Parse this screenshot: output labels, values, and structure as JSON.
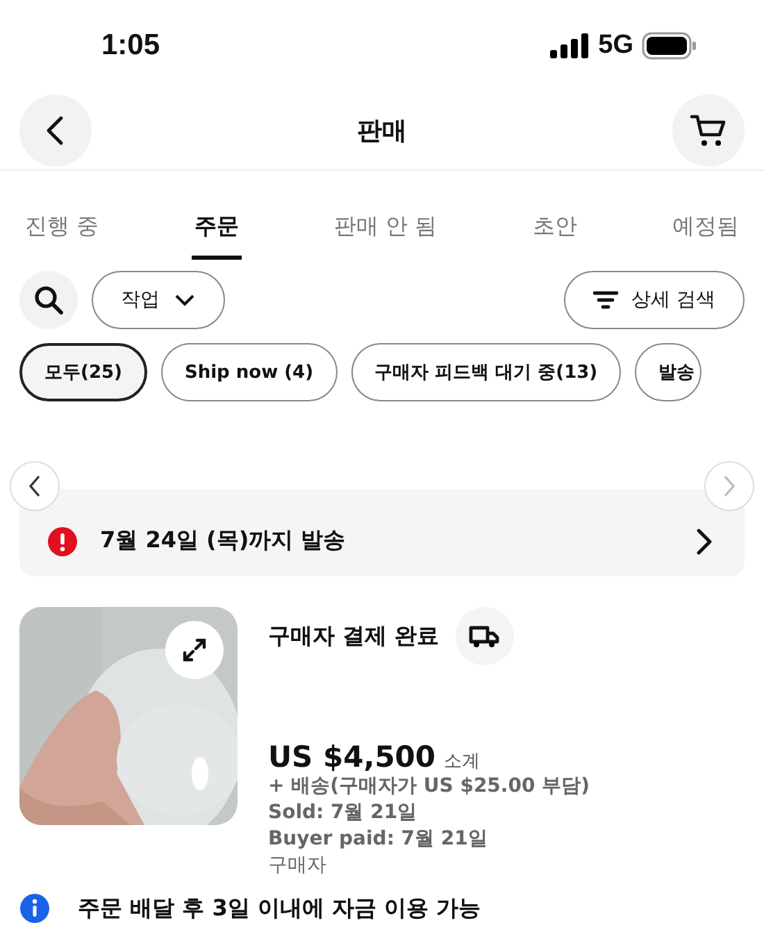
{
  "status_bar": {
    "time": "1:05",
    "network": "5G"
  },
  "header": {
    "title": "판매"
  },
  "tabs": [
    {
      "label": "진행 중",
      "selected": false
    },
    {
      "label": "주문",
      "selected": true
    },
    {
      "label": "판매 안 됨",
      "selected": false
    },
    {
      "label": "초안",
      "selected": false
    },
    {
      "label": "예정됨",
      "selected": false
    }
  ],
  "toolbar": {
    "actions_label": "작업",
    "advanced_search_label": "상세 검색"
  },
  "chips": [
    {
      "label": "모두(25)",
      "selected": true
    },
    {
      "label": "Ship now (4)",
      "selected": false
    },
    {
      "label": "구매자 피드백 대기 중(13)",
      "selected": false
    },
    {
      "label": "발송",
      "selected": false
    }
  ],
  "banner": {
    "text": "7월 24일 (목)까지 발송"
  },
  "order": {
    "status": "구매자 결제 완료",
    "price": "US $4,500",
    "price_label": "소계",
    "shipping": "+ 배송(구매자가 US $25.00 부담)",
    "sold": "Sold: 7월 21일",
    "paid": "Buyer paid: 7월 21일",
    "buyer": "구매자"
  },
  "info": {
    "text": "주문 배달 후 3일 이내에 자금 이용 가능"
  }
}
